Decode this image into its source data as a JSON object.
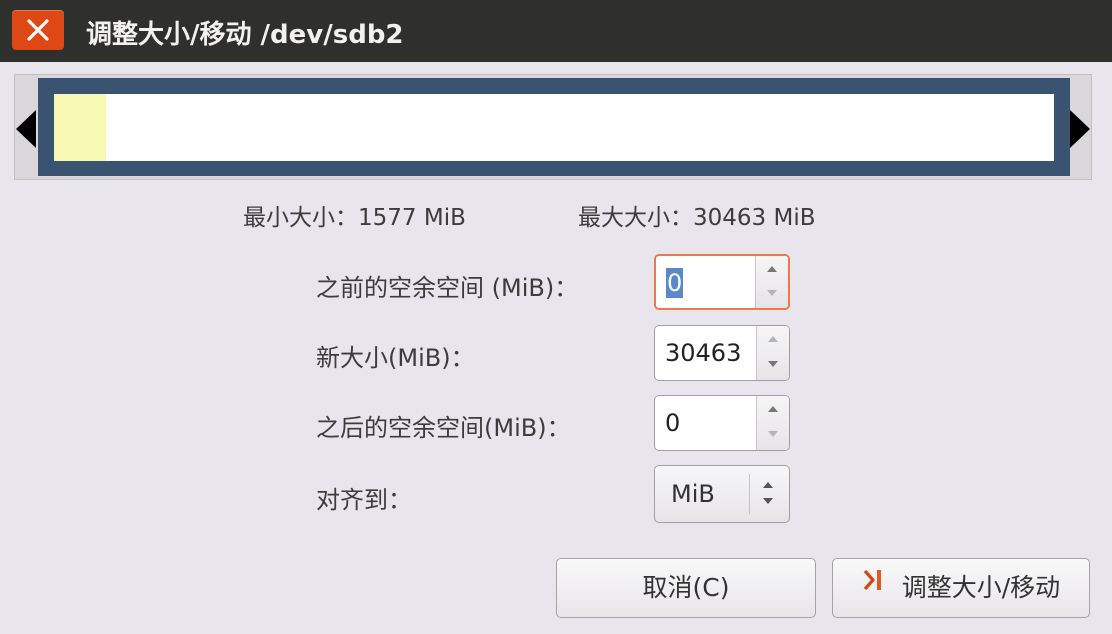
{
  "window": {
    "title": "调整大小/移动 /dev/sdb2",
    "close_icon": "close-icon"
  },
  "partition_graphic": {
    "used_fraction": 0.052,
    "colors": {
      "border": "#3a5370",
      "used": "#f7f8b2",
      "free": "#ffffff"
    }
  },
  "size_info": {
    "min_size": "最小大小：1577 MiB",
    "max_size": "最大大小：30463 MiB"
  },
  "form": {
    "free_before": {
      "label": "之前的空余空间 (MiB)：",
      "value": "0"
    },
    "new_size": {
      "label": "新大小(MiB)：",
      "value": "30463"
    },
    "free_after": {
      "label": "之后的空余空间(MiB)：",
      "value": "0"
    },
    "align_to": {
      "label": "对齐到：",
      "value": "MiB"
    }
  },
  "buttons": {
    "cancel": "取消(C)",
    "resize_move": "调整大小/移动",
    "resize_move_icon": "resize-move-icon"
  },
  "colors": {
    "titlebar": "#2f2f2d",
    "close_button": "#dd4814",
    "focus_border": "#f07746",
    "selection": "#5b88c7",
    "background": "#e9e5ed"
  }
}
